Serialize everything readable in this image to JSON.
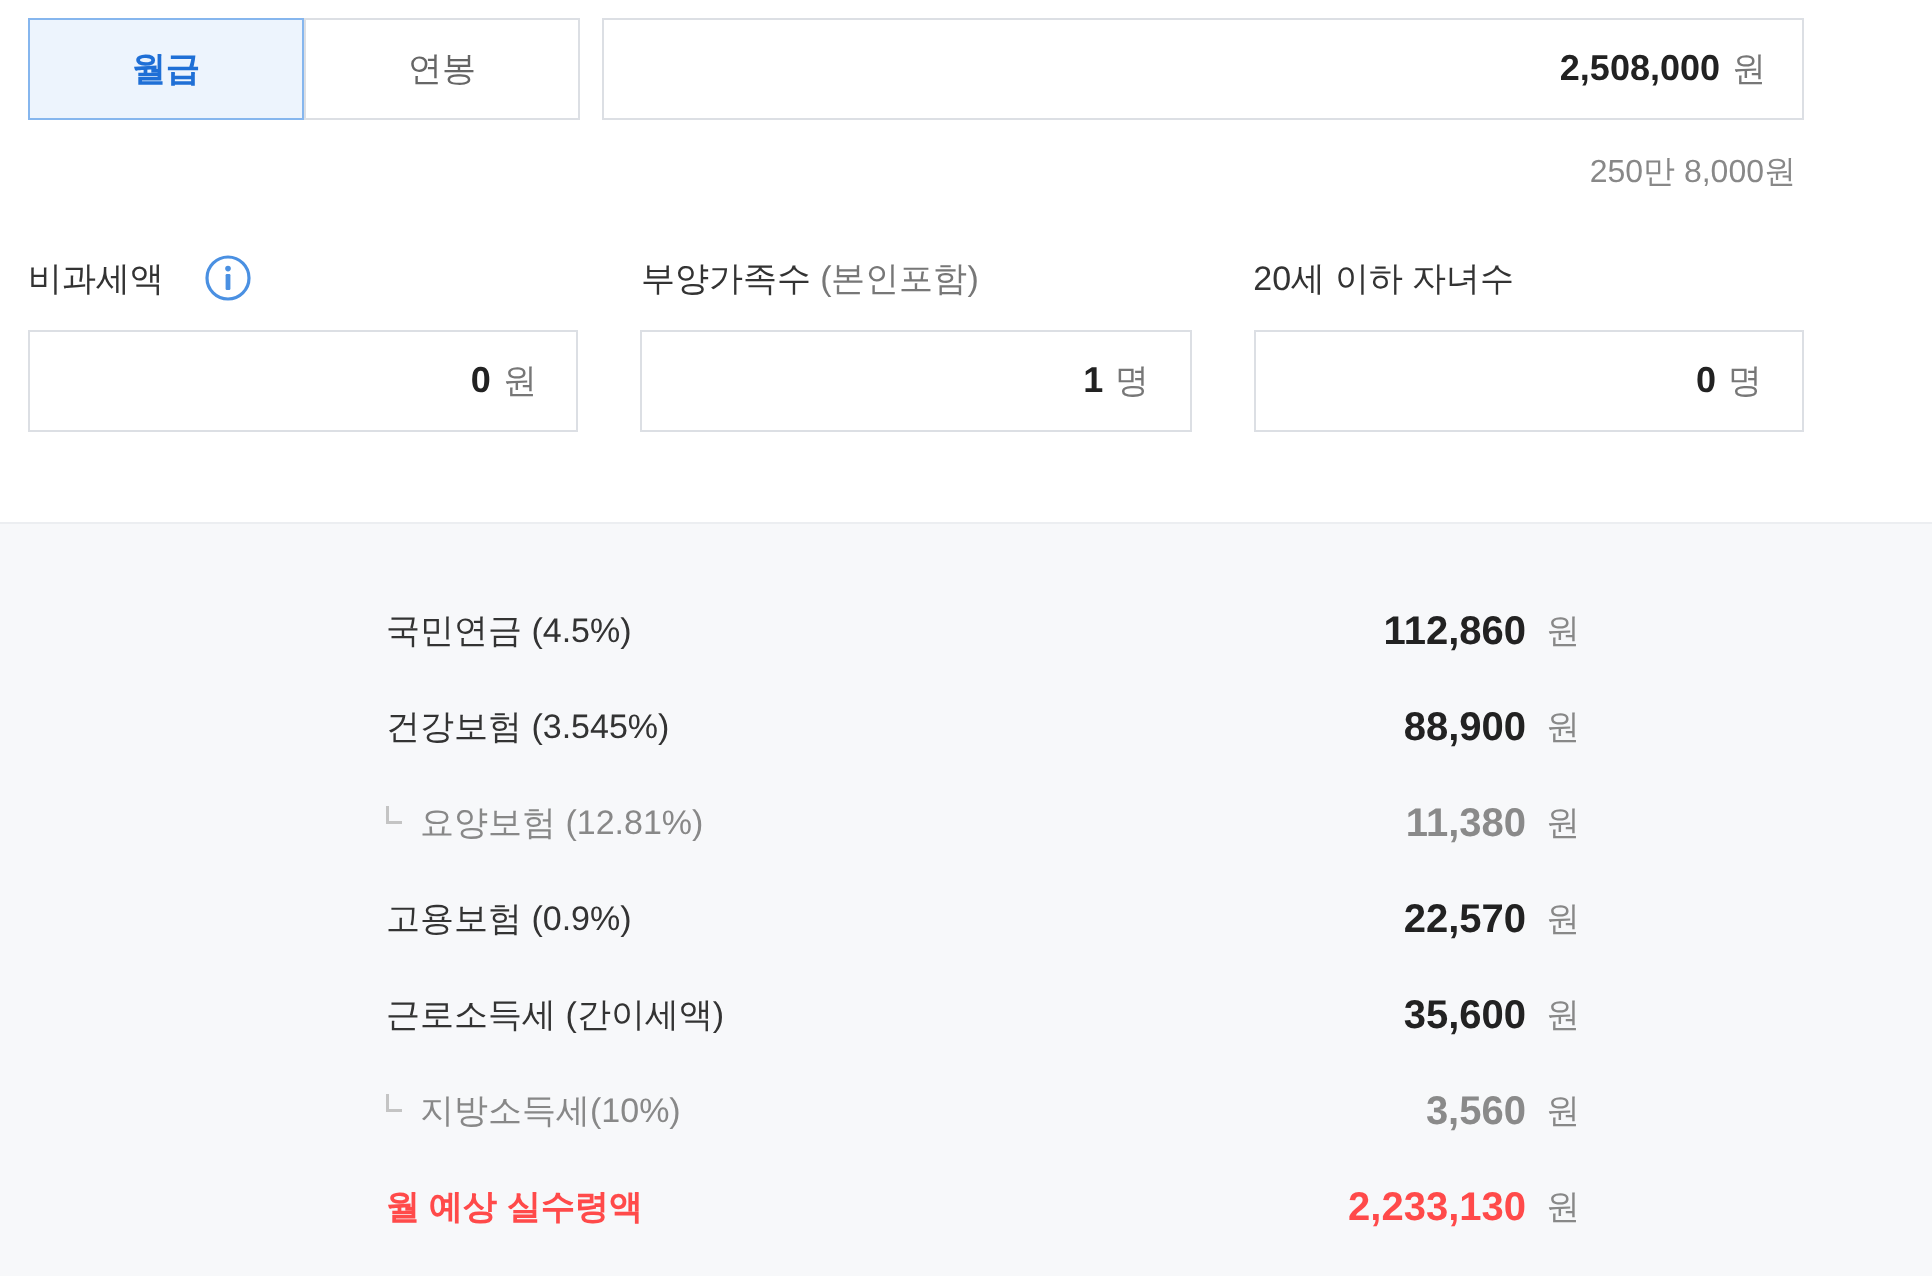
{
  "pay_type_tabs": [
    {
      "label": "월급",
      "selected": true
    },
    {
      "label": "연봉",
      "selected": false
    }
  ],
  "salary_field": {
    "value": "2,508,000",
    "unit": "원"
  },
  "salary_in_words": "250만 8,000원",
  "fields": [
    {
      "label": "비과세액",
      "info": true,
      "value": "0",
      "unit": "원"
    },
    {
      "label": "부양가족수",
      "note": "(본인포함)",
      "value": "1",
      "unit": "명"
    },
    {
      "label": "20세 이하 자녀수",
      "value": "0",
      "unit": "명"
    }
  ],
  "results": [
    {
      "kind": "main",
      "label": "국민연금 (4.5%)",
      "amount": "112,860",
      "unit": "원"
    },
    {
      "kind": "main",
      "label": "건강보험 (3.545%)",
      "amount": "88,900",
      "unit": "원"
    },
    {
      "kind": "sub",
      "label": "요양보험 (12.81%)",
      "amount": "11,380",
      "unit": "원"
    },
    {
      "kind": "main",
      "label": "고용보험 (0.9%)",
      "amount": "22,570",
      "unit": "원"
    },
    {
      "kind": "main",
      "label": "근로소득세 (간이세액)",
      "amount": "35,600",
      "unit": "원"
    },
    {
      "kind": "sub",
      "label": "지방소득세(10%)",
      "amount": "3,560",
      "unit": "원"
    },
    {
      "kind": "total",
      "label": "월 예상 실수령액",
      "amount": "2,233,130",
      "unit": "원"
    }
  ]
}
